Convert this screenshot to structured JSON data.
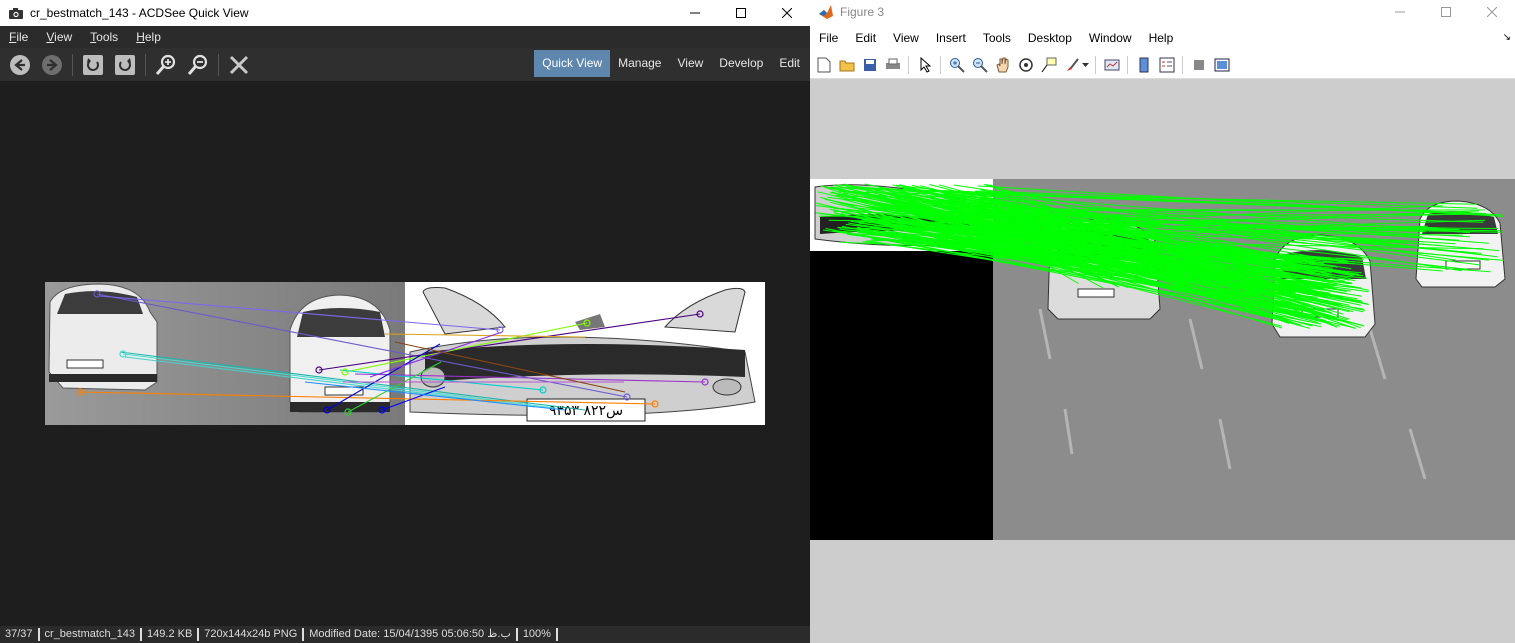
{
  "acdsee": {
    "title": "cr_bestmatch_143 - ACDSee Quick View",
    "menu": [
      "File",
      "View",
      "Tools",
      "Help"
    ],
    "modes": [
      "Quick View",
      "Manage",
      "View",
      "Develop",
      "Edit"
    ],
    "active_mode": "Quick View",
    "plate_text": "۹۳س۸۲۲ ۵۳",
    "status": {
      "position": "37/37",
      "filename": "cr_bestmatch_143",
      "filesize": "149.2 KB",
      "dimensions": "720x144x24b PNG",
      "modified": "Modified Date: 15/04/1395 05:06:50 ب.ظ",
      "zoom": "100%"
    }
  },
  "figure": {
    "title": "Figure 3",
    "menu": [
      "File",
      "Edit",
      "View",
      "Insert",
      "Tools",
      "Desktop",
      "Window",
      "Help"
    ]
  },
  "colors": {
    "accent_mode": "#5f87ad",
    "match_lines": "#00ff00"
  },
  "icons": {
    "acd_toolbar": [
      "back-icon",
      "forward-icon",
      "rotate-left-icon",
      "rotate-right-icon",
      "zoom-in-icon",
      "zoom-out-icon",
      "close-image-icon"
    ],
    "fig_toolbar": [
      "new-figure-icon",
      "open-file-icon",
      "save-icon",
      "print-icon",
      "select-arrow-icon",
      "zoom-in-icon",
      "zoom-out-icon",
      "pan-hand-icon",
      "rotate-3d-icon",
      "data-cursor-icon",
      "brush-icon",
      "link-plot-icon",
      "colorbar-icon",
      "legend-icon",
      "hide-tools-icon",
      "show-tools-icon"
    ]
  }
}
